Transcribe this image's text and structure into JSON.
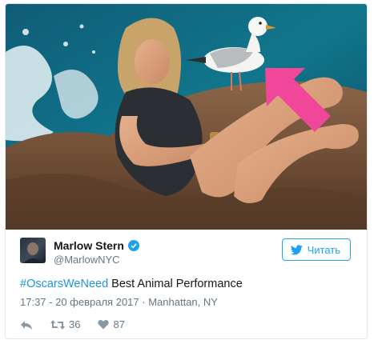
{
  "tweet": {
    "author": {
      "name": "Marlow Stern",
      "handle": "@MarlowNYC",
      "verified": true
    },
    "follow_button": {
      "label": "Читать",
      "icon": "twitter-bird-icon"
    },
    "text": {
      "hashtag": "#OscarsWeNeed",
      "body": " Best Animal Performance"
    },
    "meta": {
      "time": "17:37",
      "separator": " - ",
      "date": "20 февраля 2017",
      "dot": " · ",
      "location": "Manhattan, NY"
    },
    "actions": {
      "reply_icon": "reply-icon",
      "retweet_icon": "retweet-icon",
      "retweet_count": "36",
      "like_icon": "heart-icon",
      "like_count": "87"
    },
    "media": {
      "description_icon": "photo-woman-on-rock-with-seagull",
      "arrow_color": "#f0479a"
    }
  },
  "colors": {
    "accent": "#1da1f2",
    "hashtag": "#1b95e0",
    "text": "#14171a",
    "muted": "#657786",
    "border": "#e1e8ed"
  }
}
